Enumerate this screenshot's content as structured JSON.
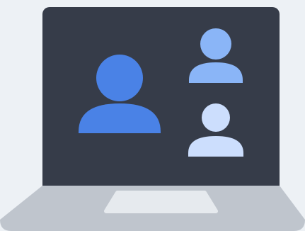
{
  "illustration": {
    "subject": "laptop-video-call",
    "participants": [
      {
        "role": "main-participant",
        "color": "#4A82E6"
      },
      {
        "role": "secondary-participant-top",
        "color": "#8AB5F7"
      },
      {
        "role": "secondary-participant-bottom",
        "color": "#CCDEFD"
      }
    ]
  },
  "colors": {
    "background": "#EDF1F5",
    "screen": "#363C49",
    "laptop_base": "#BFC5CD",
    "trackpad": "#E6EAEE"
  }
}
